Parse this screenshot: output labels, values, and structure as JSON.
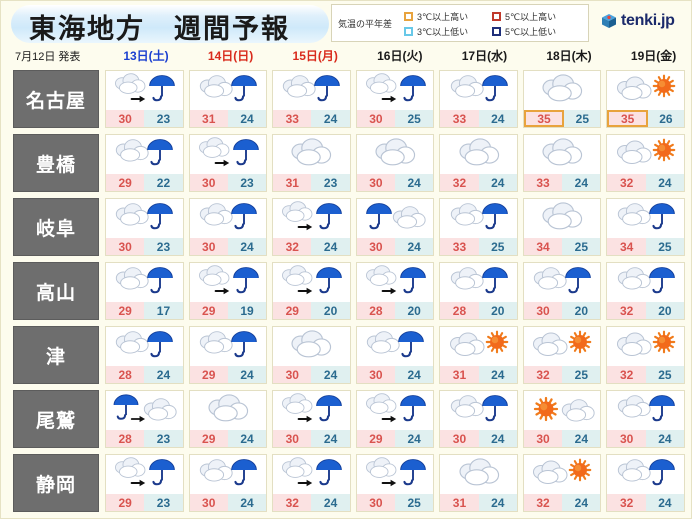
{
  "header": {
    "title": "東海地方　週間予報",
    "issue_date": "7月12日 発表",
    "legend": {
      "label": "気温の平年差",
      "items": [
        {
          "text": "3℃以上高い",
          "color": "#e8a33d"
        },
        {
          "text": "5℃以上高い",
          "color": "#c0392b"
        },
        {
          "text": "3℃以上低い",
          "color": "#68c8e8"
        },
        {
          "text": "5℃以上低い",
          "color": "#1f2f7a"
        }
      ]
    },
    "logo": {
      "text": "tenki.jp",
      "icon": "cube-logo-icon"
    }
  },
  "days": [
    {
      "label": "13日(土)",
      "color": "#1a3fd0"
    },
    {
      "label": "14日(日)",
      "color": "#d92b1c"
    },
    {
      "label": "15日(月)",
      "color": "#d92b1c"
    },
    {
      "label": "16日(火)",
      "color": "#1a1a1a"
    },
    {
      "label": "17日(水)",
      "color": "#1a1a1a"
    },
    {
      "label": "18日(木)",
      "color": "#1a1a1a"
    },
    {
      "label": "19日(金)",
      "color": "#1a1a1a"
    }
  ],
  "rows": [
    {
      "city": "名古屋",
      "cells": [
        {
          "icon": "cloud-then-rain",
          "max": "30",
          "min": "23",
          "max_dev": "",
          "min_dev": ""
        },
        {
          "icon": "cloud-rain",
          "max": "31",
          "min": "24",
          "max_dev": "",
          "min_dev": ""
        },
        {
          "icon": "cloud-rain",
          "max": "33",
          "min": "24",
          "max_dev": "",
          "min_dev": ""
        },
        {
          "icon": "cloud-then-rain",
          "max": "30",
          "min": "25",
          "max_dev": "",
          "min_dev": ""
        },
        {
          "icon": "cloud-rain",
          "max": "33",
          "min": "24",
          "max_dev": "",
          "min_dev": ""
        },
        {
          "icon": "cloud",
          "max": "35",
          "min": "25",
          "max_dev": "warm3",
          "min_dev": ""
        },
        {
          "icon": "cloud-sun",
          "max": "35",
          "min": "26",
          "max_dev": "warm3",
          "min_dev": ""
        }
      ]
    },
    {
      "city": "豊橋",
      "cells": [
        {
          "icon": "cloud-rain",
          "max": "29",
          "min": "22",
          "max_dev": "",
          "min_dev": ""
        },
        {
          "icon": "cloud-then-rain",
          "max": "30",
          "min": "23",
          "max_dev": "",
          "min_dev": ""
        },
        {
          "icon": "cloud",
          "max": "31",
          "min": "23",
          "max_dev": "",
          "min_dev": ""
        },
        {
          "icon": "cloud",
          "max": "30",
          "min": "24",
          "max_dev": "",
          "min_dev": ""
        },
        {
          "icon": "cloud",
          "max": "32",
          "min": "24",
          "max_dev": "",
          "min_dev": ""
        },
        {
          "icon": "cloud",
          "max": "33",
          "min": "24",
          "max_dev": "",
          "min_dev": ""
        },
        {
          "icon": "cloud-sun",
          "max": "32",
          "min": "24",
          "max_dev": "",
          "min_dev": ""
        }
      ]
    },
    {
      "city": "岐阜",
      "cells": [
        {
          "icon": "cloud-rain",
          "max": "30",
          "min": "23",
          "max_dev": "",
          "min_dev": ""
        },
        {
          "icon": "cloud-rain",
          "max": "30",
          "min": "24",
          "max_dev": "",
          "min_dev": ""
        },
        {
          "icon": "cloud-then-rain",
          "max": "32",
          "min": "24",
          "max_dev": "",
          "min_dev": ""
        },
        {
          "icon": "rain-cloud",
          "max": "30",
          "min": "24",
          "max_dev": "",
          "min_dev": ""
        },
        {
          "icon": "cloud-rain",
          "max": "33",
          "min": "25",
          "max_dev": "",
          "min_dev": ""
        },
        {
          "icon": "cloud",
          "max": "34",
          "min": "25",
          "max_dev": "",
          "min_dev": ""
        },
        {
          "icon": "cloud-rain",
          "max": "34",
          "min": "25",
          "max_dev": "",
          "min_dev": ""
        }
      ]
    },
    {
      "city": "高山",
      "cells": [
        {
          "icon": "cloud-rain",
          "max": "29",
          "min": "17",
          "max_dev": "",
          "min_dev": ""
        },
        {
          "icon": "cloud-then-rain",
          "max": "29",
          "min": "19",
          "max_dev": "",
          "min_dev": ""
        },
        {
          "icon": "cloud-then-rain",
          "max": "29",
          "min": "20",
          "max_dev": "",
          "min_dev": ""
        },
        {
          "icon": "cloud-then-rain",
          "max": "28",
          "min": "20",
          "max_dev": "",
          "min_dev": ""
        },
        {
          "icon": "cloud-rain",
          "max": "28",
          "min": "20",
          "max_dev": "",
          "min_dev": ""
        },
        {
          "icon": "cloud-rain",
          "max": "30",
          "min": "20",
          "max_dev": "",
          "min_dev": ""
        },
        {
          "icon": "cloud-rain",
          "max": "32",
          "min": "20",
          "max_dev": "",
          "min_dev": ""
        }
      ]
    },
    {
      "city": "津",
      "cells": [
        {
          "icon": "cloud-rain",
          "max": "28",
          "min": "24",
          "max_dev": "",
          "min_dev": ""
        },
        {
          "icon": "cloud-rain",
          "max": "29",
          "min": "24",
          "max_dev": "",
          "min_dev": ""
        },
        {
          "icon": "cloud",
          "max": "30",
          "min": "24",
          "max_dev": "",
          "min_dev": ""
        },
        {
          "icon": "cloud-rain",
          "max": "30",
          "min": "24",
          "max_dev": "",
          "min_dev": ""
        },
        {
          "icon": "cloud-sun",
          "max": "31",
          "min": "24",
          "max_dev": "",
          "min_dev": ""
        },
        {
          "icon": "cloud-sun",
          "max": "32",
          "min": "25",
          "max_dev": "",
          "min_dev": ""
        },
        {
          "icon": "cloud-sun",
          "max": "32",
          "min": "25",
          "max_dev": "",
          "min_dev": ""
        }
      ]
    },
    {
      "city": "尾鷲",
      "cells": [
        {
          "icon": "rain-then-cloud",
          "max": "28",
          "min": "23",
          "max_dev": "",
          "min_dev": ""
        },
        {
          "icon": "cloud",
          "max": "29",
          "min": "24",
          "max_dev": "",
          "min_dev": ""
        },
        {
          "icon": "cloud-then-rain",
          "max": "30",
          "min": "24",
          "max_dev": "",
          "min_dev": ""
        },
        {
          "icon": "cloud-then-rain",
          "max": "29",
          "min": "24",
          "max_dev": "",
          "min_dev": ""
        },
        {
          "icon": "cloud-rain",
          "max": "30",
          "min": "24",
          "max_dev": "",
          "min_dev": ""
        },
        {
          "icon": "sun-cloud",
          "max": "30",
          "min": "24",
          "max_dev": "",
          "min_dev": ""
        },
        {
          "icon": "cloud-rain",
          "max": "30",
          "min": "24",
          "max_dev": "",
          "min_dev": ""
        }
      ]
    },
    {
      "city": "静岡",
      "cells": [
        {
          "icon": "cloud-then-rain",
          "max": "29",
          "min": "23",
          "max_dev": "",
          "min_dev": ""
        },
        {
          "icon": "cloud-rain",
          "max": "30",
          "min": "24",
          "max_dev": "",
          "min_dev": ""
        },
        {
          "icon": "cloud-then-rain",
          "max": "32",
          "min": "24",
          "max_dev": "",
          "min_dev": ""
        },
        {
          "icon": "cloud-then-rain",
          "max": "30",
          "min": "25",
          "max_dev": "",
          "min_dev": ""
        },
        {
          "icon": "cloud",
          "max": "31",
          "min": "24",
          "max_dev": "",
          "min_dev": ""
        },
        {
          "icon": "cloud-sun",
          "max": "32",
          "min": "24",
          "max_dev": "",
          "min_dev": ""
        },
        {
          "icon": "cloud-rain",
          "max": "32",
          "min": "24",
          "max_dev": "",
          "min_dev": ""
        }
      ]
    }
  ]
}
